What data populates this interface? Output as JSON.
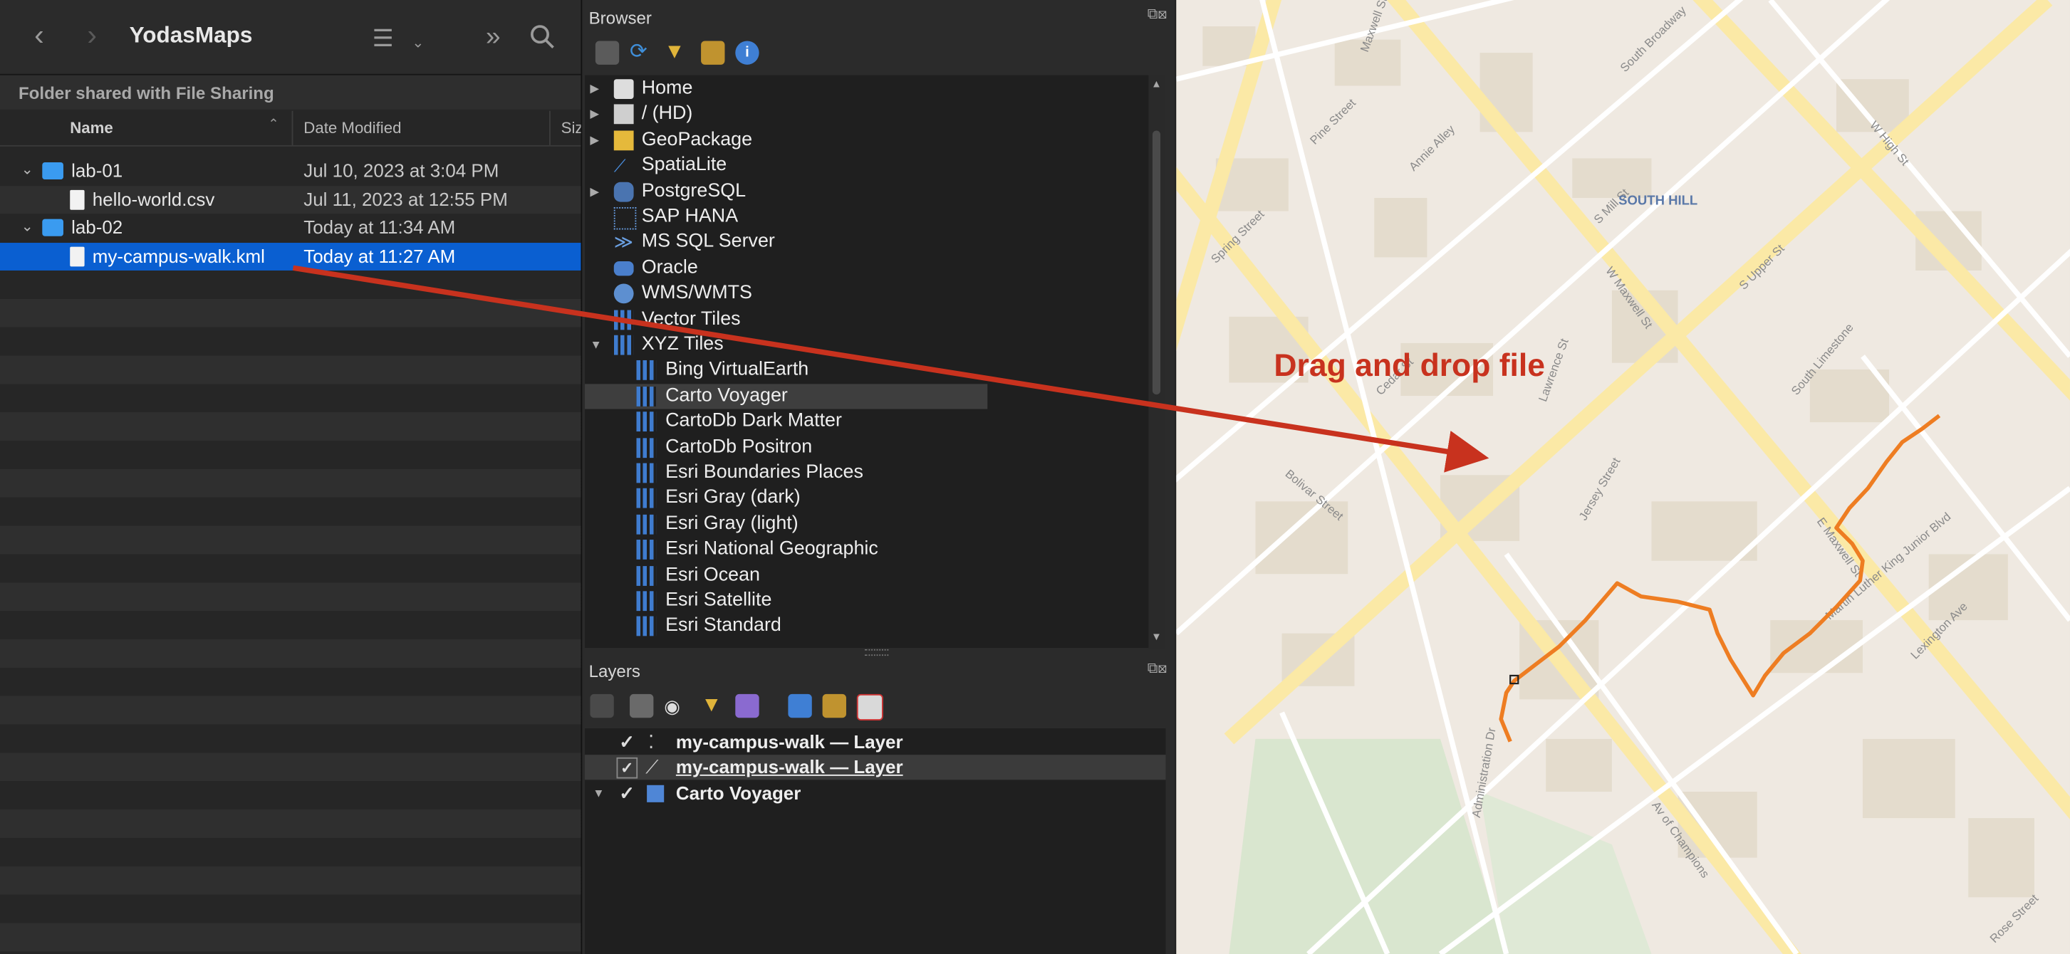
{
  "finder": {
    "title": "YodasMaps",
    "shared_banner": "Folder shared with File Sharing",
    "columns": {
      "name": "Name",
      "date": "Date Modified",
      "size": "Siz"
    },
    "rows": [
      {
        "name": "lab-01",
        "date": "Jul 10, 2023 at 3:04 PM",
        "kind": "folder"
      },
      {
        "name": "hello-world.csv",
        "date": "Jul 11, 2023 at 12:55 PM",
        "kind": "file"
      },
      {
        "name": "lab-02",
        "date": "Today at 11:34 AM",
        "kind": "folder"
      },
      {
        "name": "my-campus-walk.kml",
        "date": "Today at 11:27 AM",
        "kind": "file",
        "selected": true
      }
    ]
  },
  "browser": {
    "title": "Browser",
    "items": [
      "Home",
      "/ (HD)",
      "GeoPackage",
      "SpatiaLite",
      "PostgreSQL",
      "SAP HANA",
      "MS SQL Server",
      "Oracle",
      "WMS/WMTS",
      "Vector Tiles",
      "XYZ Tiles"
    ],
    "xyz_children": [
      "Bing VirtualEarth",
      "Carto Voyager",
      "CartoDb Dark Matter",
      "CartoDb Positron",
      "Esri Boundaries Places",
      "Esri Gray (dark)",
      "Esri Gray (light)",
      "Esri National Geographic",
      "Esri Ocean",
      "Esri Satellite",
      "Esri Standard"
    ],
    "selected": "Carto Voyager"
  },
  "layers": {
    "title": "Layers",
    "items": [
      "my-campus-walk — Layer",
      "my-campus-walk — Layer",
      "Carto Voyager"
    ]
  },
  "map": {
    "annotation": "Drag and drop file",
    "annotation_color": "#c8321e",
    "track_color": "#ee7d22",
    "labels": {
      "neighborhood": "SOUTH HILL",
      "s1": "Maxwell St",
      "s2": "South Broadway",
      "s3": "Pine Street",
      "s4": "Spring Street",
      "s5": "Annie Alley",
      "s6": "S Mill St",
      "s7": "S Upper St",
      "s8": "W High St",
      "s9": "South Limestone",
      "s10": "Bolivar Street",
      "s11": "E Maxwell St",
      "s12": "Martin Luther King Junior Blvd",
      "s13": "Av of Champions",
      "s14": "Administration Dr",
      "s15": "Lexington Ave",
      "s16": "Rose Street",
      "s17": "Jersey Street",
      "s18": "W Maxwell St",
      "s19": "Cedar St",
      "s20": "Lawrence St"
    }
  }
}
